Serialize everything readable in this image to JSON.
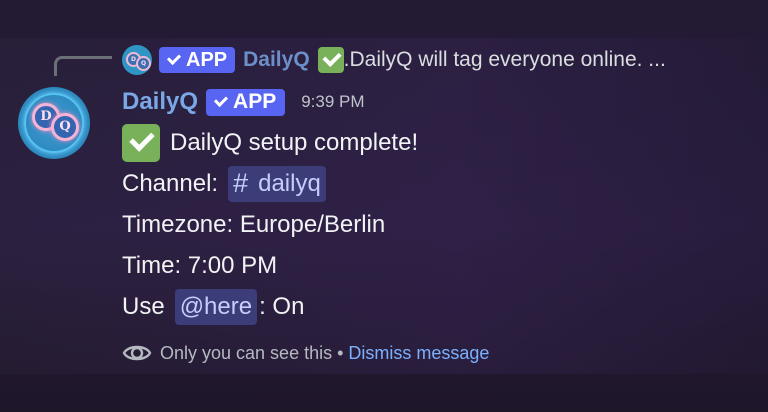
{
  "reply": {
    "app_badge": "APP",
    "author": "DailyQ",
    "text": ".DailyQ will tag everyone online. ..."
  },
  "message": {
    "author": "DailyQ",
    "app_badge": "APP",
    "timestamp": "9:39 PM",
    "lines": {
      "setup": "DailyQ setup complete!",
      "channel_label": "Channel:",
      "channel_name": "dailyq",
      "timezone": "Timezone: Europe/Berlin",
      "time": "Time: 7:00 PM",
      "use_label": "Use",
      "here_mention": "@here",
      "here_value": ": On"
    }
  },
  "footer": {
    "note": "Only you can see this",
    "separator": "•",
    "dismiss": "Dismiss message"
  },
  "avatar": {
    "letter_1": "D",
    "letter_2": "Q"
  },
  "icons": {
    "checkmark": "check-mark-emoji",
    "eye": "eye-icon",
    "verified": "verified-check-icon"
  },
  "colors": {
    "app_badge": "#5865f2",
    "author": "#7aa7e6",
    "link": "#7bb0ff",
    "mention_bg": "#3b3c78",
    "check_emoji": "#78b159"
  }
}
